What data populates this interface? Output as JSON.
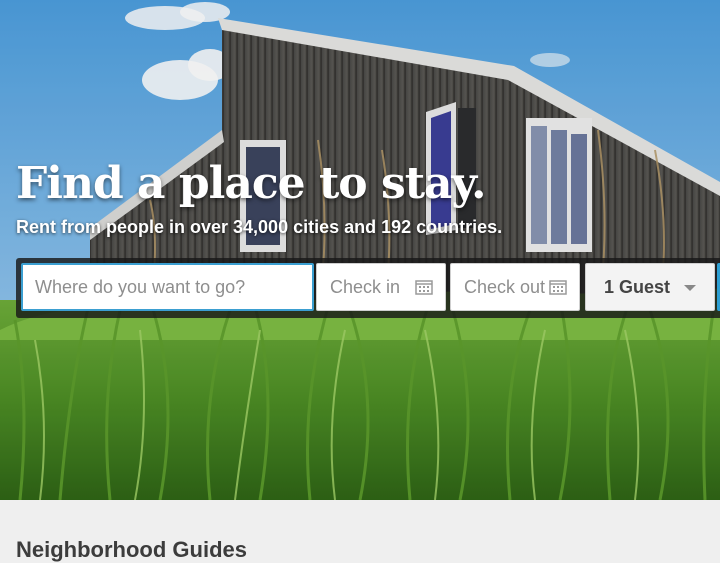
{
  "hero": {
    "headline": "Find a place to stay.",
    "subheadline": "Rent from people in over 34,000 cities and 192 countries."
  },
  "search": {
    "where_placeholder": "Where do you want to go?",
    "checkin_label": "Check in",
    "checkout_label": "Check out",
    "guests_value": "1 Guest",
    "accent_color": "#3b9fd1"
  },
  "section": {
    "title": "Neighborhood Guides"
  },
  "icons": [
    "calendar-icon",
    "chevron-down-icon"
  ]
}
